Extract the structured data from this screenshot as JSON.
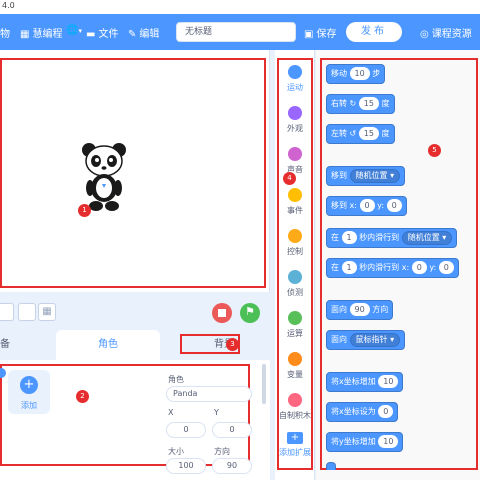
{
  "window": {
    "version": "4.0"
  },
  "menubar": {
    "items": [
      {
        "label": "物",
        "icon": ""
      },
      {
        "label": "慧编程",
        "icon": "grid-icon"
      },
      {
        "label": "",
        "icon": "globe-icon"
      },
      {
        "label": "文件",
        "icon": "folder-icon"
      },
      {
        "label": "编辑",
        "icon": "wrench-icon"
      }
    ],
    "project_title": "无标题",
    "save_label": "保存",
    "publish_label": "发布",
    "course_label": "课程资源"
  },
  "stage": {
    "sprite_icon": "panda-sprite",
    "badge": "1"
  },
  "tabs": {
    "devices": "备",
    "sprites": "角色",
    "backdrops": "背景",
    "badge3": "3"
  },
  "sprite_panel": {
    "add_label": "添加",
    "badge": "2",
    "sprite_label": "角色",
    "sprite_name": "Panda",
    "x_label": "X",
    "x_value": "0",
    "y_label": "Y",
    "y_value": "0",
    "size_label": "大小",
    "size_value": "100",
    "direction_label": "方向",
    "direction_value": "90"
  },
  "categories": [
    {
      "label": "运动",
      "color": "#4c97ff"
    },
    {
      "label": "外观",
      "color": "#9966ff"
    },
    {
      "label": "声音",
      "color": "#cf63cf"
    },
    {
      "label": "事件",
      "color": "#ffbf00"
    },
    {
      "label": "控制",
      "color": "#ffab19"
    },
    {
      "label": "侦测",
      "color": "#5cb1d6"
    },
    {
      "label": "运算",
      "color": "#59c059"
    },
    {
      "label": "变量",
      "color": "#ff8c1a"
    },
    {
      "label": "自制积木",
      "color": "#ff6680"
    }
  ],
  "category_extras": {
    "add_extension": "添加扩展",
    "badge": "4"
  },
  "blocks": {
    "badge": "5",
    "move": {
      "pre": "移动",
      "v": "10",
      "post": "步"
    },
    "turn_right": {
      "pre": "右转",
      "v": "15",
      "post": "度"
    },
    "turn_left": {
      "pre": "左转",
      "v": "15",
      "post": "度"
    },
    "goto": {
      "pre": "移到",
      "d": "随机位置"
    },
    "goto_xy": {
      "pre": "移到 x:",
      "x": "0",
      "mid": "y:",
      "y": "0"
    },
    "glide_to": {
      "pre": "在",
      "v": "1",
      "mid": "秒内滑行到",
      "d": "随机位置"
    },
    "glide_xy": {
      "pre": "在",
      "v": "1",
      "mid": "秒内滑行到 x:",
      "x": "0",
      "ylab": "y:",
      "y": "0"
    },
    "point_dir": {
      "pre": "面向",
      "v": "90",
      "post": "方向"
    },
    "point_towards": {
      "pre": "面向",
      "d": "鼠标指针"
    },
    "change_x": {
      "pre": "将x坐标增加",
      "v": "10"
    },
    "set_x": {
      "pre": "将x坐标设为",
      "v": "0"
    },
    "change_y": {
      "pre": "将y坐标增加",
      "v": "10"
    }
  },
  "colors": {
    "accent": "#4c97ff",
    "annotation": "#e62d2d"
  }
}
